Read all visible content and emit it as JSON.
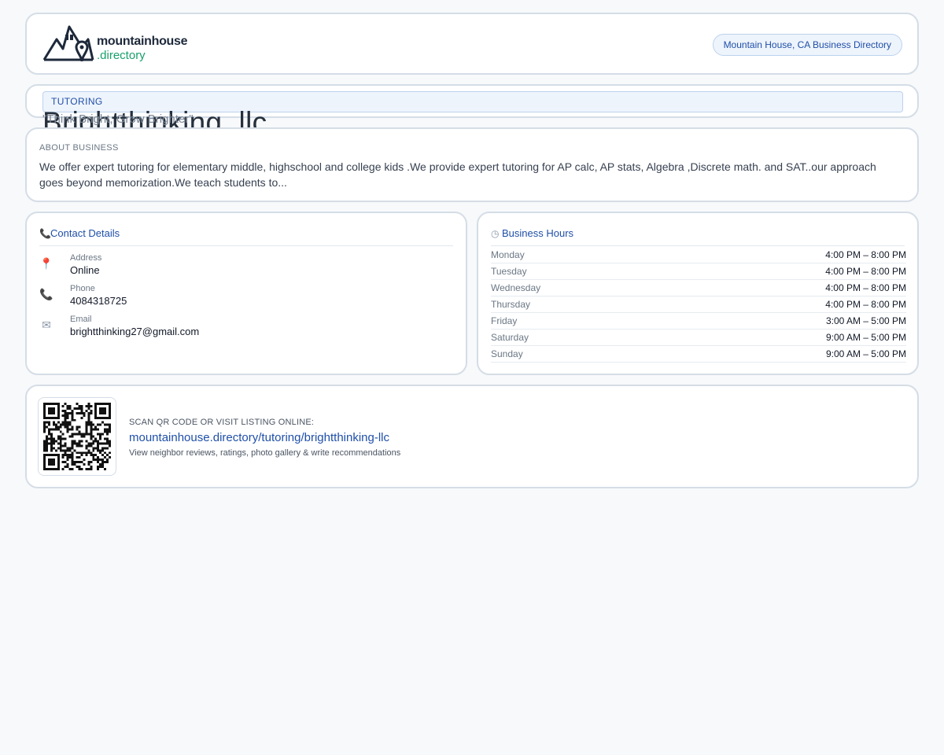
{
  "header": {
    "logo_line1": "mountainhouse",
    "logo_line2": ".directory",
    "directory_badge": "Mountain House, CA Business Directory"
  },
  "business": {
    "category": "TUTORING",
    "name": "Brightthinking, llc",
    "tagline": "\"Think Bright, Grow Brighter\""
  },
  "about": {
    "heading": "ABOUT BUSINESS",
    "text": "We offer expert  tutoring for elementary middle, highschool and college kids .We provide expert tutoring for AP calc, AP stats, Algebra ,Discrete  math. and SAT..our approach goes beyond memorization.We  teach students to..."
  },
  "contact": {
    "title": "Contact Details",
    "icon": "phone-icon",
    "rows": [
      {
        "icon": "pin-icon",
        "label": "Address",
        "value": "Online"
      },
      {
        "icon": "phone-icon",
        "label": "Phone",
        "value": "4084318725"
      },
      {
        "icon": "mail-icon",
        "label": "Email",
        "value": "brightthinking27@gmail.com"
      }
    ]
  },
  "hours": {
    "title": "Business Hours",
    "icon": "clock-icon",
    "rows": [
      {
        "day": "Monday",
        "time": "4:00 PM – 8:00 PM"
      },
      {
        "day": "Tuesday",
        "time": "4:00 PM – 8:00 PM"
      },
      {
        "day": "Wednesday",
        "time": "4:00 PM – 8:00 PM"
      },
      {
        "day": "Thursday",
        "time": "4:00 PM – 8:00 PM"
      },
      {
        "day": "Friday",
        "time": "3:00 AM – 5:00 PM"
      },
      {
        "day": "Saturday",
        "time": "9:00 AM – 5:00 PM"
      },
      {
        "day": "Sunday",
        "time": "9:00 AM – 5:00 PM"
      }
    ]
  },
  "qr": {
    "label": "SCAN QR CODE OR VISIT LISTING ONLINE:",
    "url": "mountainhouse.directory/tutoring/brightthinking-llc",
    "note": "View neighbor reviews, ratings, photo gallery & write recommendations"
  },
  "colors": {
    "accent": "#1f4fa8",
    "brand_green": "#18a06c",
    "border": "#d5dde6",
    "background": "#f7f9fb"
  }
}
